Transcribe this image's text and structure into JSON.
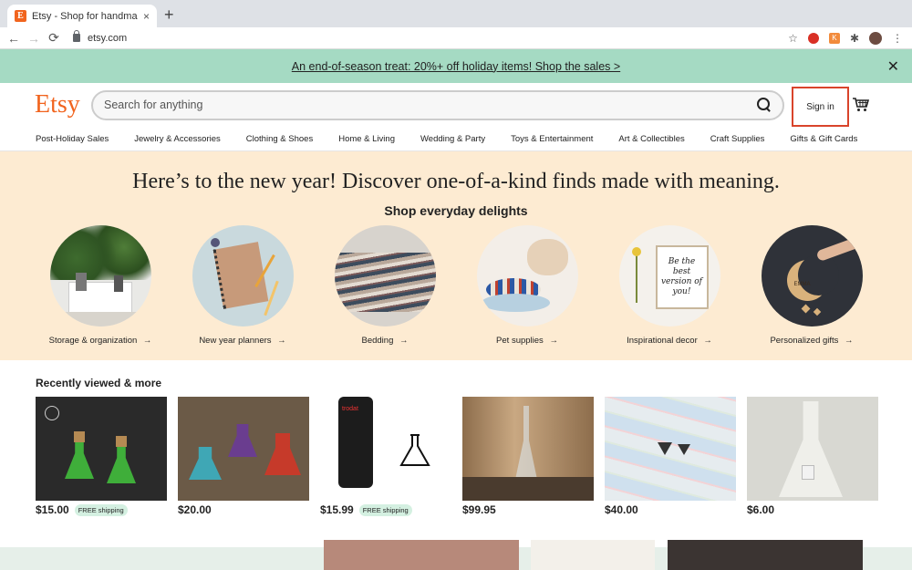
{
  "browser": {
    "tab_title": "Etsy - Shop for handmade, vin",
    "favicon_letter": "E",
    "tab_close": "×",
    "new_tab": "+",
    "url": "etsy.com",
    "nav": {
      "back": "←",
      "forward": "→",
      "reload": "⟳"
    },
    "icons": {
      "star": "☆",
      "extensions": "✱",
      "menu": "⋮",
      "orange_ext": "K"
    }
  },
  "promo": {
    "text": "An end-of-season treat: 20%+ off holiday items! Shop the sales >",
    "close": "✕"
  },
  "header": {
    "logo": "Etsy",
    "search_placeholder": "Search for anything",
    "sign_in": "Sign in"
  },
  "categories": [
    "Post-Holiday Sales",
    "Jewelry & Accessories",
    "Clothing & Shoes",
    "Home & Living",
    "Wedding & Party",
    "Toys & Entertainment",
    "Art & Collectibles",
    "Craft Supplies",
    "Gifts & Gift Cards"
  ],
  "hero": {
    "headline": "Here’s to the new year! Discover one-of-a-kind finds made with meaning.",
    "subhead": "Shop everyday delights",
    "tiles": [
      {
        "label": "Storage & organization"
      },
      {
        "label": "New year planners"
      },
      {
        "label": "Bedding"
      },
      {
        "label": "Pet supplies"
      },
      {
        "label": "Inspirational decor",
        "sign_text": "Be the best version of you!"
      },
      {
        "label": "Personalized gifts",
        "tag_text": "EMMA"
      }
    ]
  },
  "recent": {
    "title": "Recently viewed & more",
    "items": [
      {
        "price": "$15.00",
        "shipping": "FREE shipping"
      },
      {
        "price": "$20.00",
        "shipping": ""
      },
      {
        "price": "$15.99",
        "shipping": "FREE shipping",
        "stamp_text": "trodat"
      },
      {
        "price": "$99.95",
        "shipping": ""
      },
      {
        "price": "$40.00",
        "shipping": ""
      },
      {
        "price": "$6.00",
        "shipping": ""
      }
    ]
  }
}
